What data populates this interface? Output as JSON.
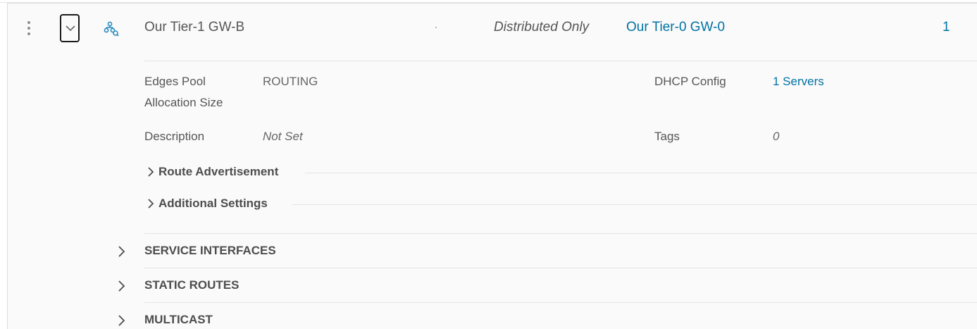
{
  "gateway": {
    "name": "Our Tier-1 GW-B",
    "ha_mode": "Distributed Only",
    "linked_tier0": "Our Tier-0 GW-0",
    "count": "1"
  },
  "details": {
    "edges_pool_label_line1": "Edges Pool",
    "edges_pool_label_line2": "Allocation Size",
    "edges_pool_value": "ROUTING",
    "dhcp_label": "DHCP Config",
    "dhcp_value": "1 Servers",
    "description_label": "Description",
    "description_value": "Not Set",
    "tags_label": "Tags",
    "tags_value": "0"
  },
  "subsections": [
    {
      "label": "Route Advertisement"
    },
    {
      "label": "Additional Settings"
    }
  ],
  "groups": [
    {
      "label": "SERVICE INTERFACES"
    },
    {
      "label": "STATIC ROUTES"
    },
    {
      "label": "MULTICAST"
    }
  ],
  "icons": {
    "row_menu": "vertical-ellipsis-icon",
    "collapse": "chevron-down-icon",
    "gateway_type": "tier1-gateway-icon",
    "expand": "chevron-right-icon"
  },
  "colors": {
    "link": "#0072a3",
    "icon_accent": "#2e8bc0",
    "panel_bg": "#fafafa"
  }
}
